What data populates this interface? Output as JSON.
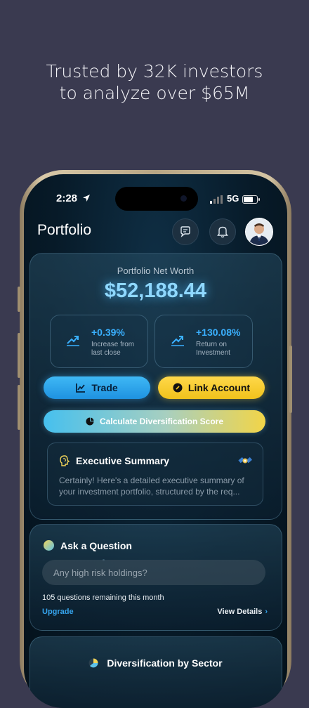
{
  "headline": {
    "line1": "Trusted by 32K investors",
    "line2": "to analyze over $65M"
  },
  "status_bar": {
    "time": "2:28",
    "network": "5G"
  },
  "header": {
    "title": "Portfolio",
    "chat_icon": "chat-icon",
    "bell_icon": "bell-icon"
  },
  "net_worth": {
    "label": "Portfolio Net Worth",
    "value": "$52,188.44"
  },
  "stats": [
    {
      "value": "+0.39%",
      "caption_line1": "Increase from",
      "caption_line2": "last close"
    },
    {
      "value": "+130.08%",
      "caption_line1": "Return on",
      "caption_line2": "Investment"
    }
  ],
  "buttons": {
    "trade": "Trade",
    "link_account": "Link Account",
    "diversification": "Calculate Diversification Score"
  },
  "executive_summary": {
    "title": "Executive Summary",
    "line1": "Certainly! Here's a detailed executive summary of",
    "line2": "your investment portfolio, structured by the req..."
  },
  "ask": {
    "title": "Ask a Question",
    "placeholder": "Any high risk holdings?",
    "remaining": "105 questions remaining this month",
    "upgrade": "Upgrade",
    "view_details": "View Details"
  },
  "diversification_section": {
    "title": "Diversification by Sector"
  },
  "colors": {
    "background": "#3a3a50",
    "accent_blue": "#3ab0ff",
    "accent_yellow": "#f0c21c"
  }
}
